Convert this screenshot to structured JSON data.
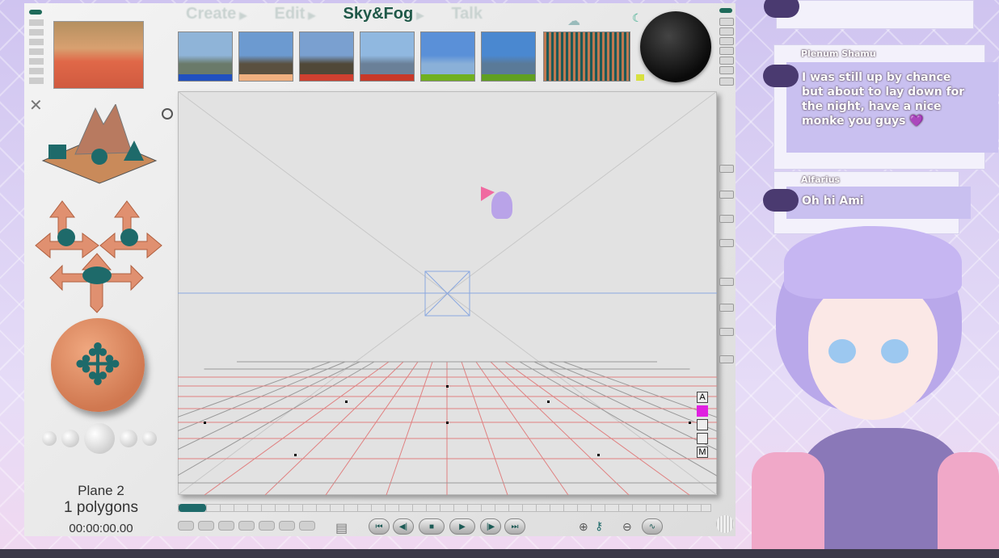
{
  "menu": {
    "items": [
      "Create",
      "Edit",
      "Sky&Fog",
      "Talk"
    ],
    "active": "Sky&Fog"
  },
  "thumbnails": [
    {
      "sky": "#8fb4d8",
      "ground": "#6a7a6a",
      "strip": "#2050c0"
    },
    {
      "sky": "#6c9ad0",
      "ground": "#5a5040",
      "strip": "#f0b080"
    },
    {
      "sky": "#7aa0d0",
      "ground": "#504838",
      "strip": "#d04030"
    },
    {
      "sky": "#90b8e0",
      "ground": "#6a8098",
      "strip": "#c83828"
    },
    {
      "sky": "#5a90d8",
      "ground": "#8ab0d8",
      "strip": "#70b020"
    },
    {
      "sky": "#4a88d0",
      "ground": "#5a7a98",
      "strip": "#60a020"
    }
  ],
  "status": {
    "object": "Plane 2",
    "polygons": "1 polygons",
    "time": "00:00:00.00"
  },
  "canvas_labels": {
    "a": "A",
    "m": "M"
  },
  "chat": [
    {
      "user": "Plenum Shamu",
      "message": "I was still up by chance but about to lay down for the night, have a nice monke you guys 💜"
    },
    {
      "user": "Alfarius",
      "message": "Oh hi Ami"
    }
  ],
  "colors": {
    "accent": "#1f5848",
    "chat_bubble": "#c9c0f0"
  }
}
